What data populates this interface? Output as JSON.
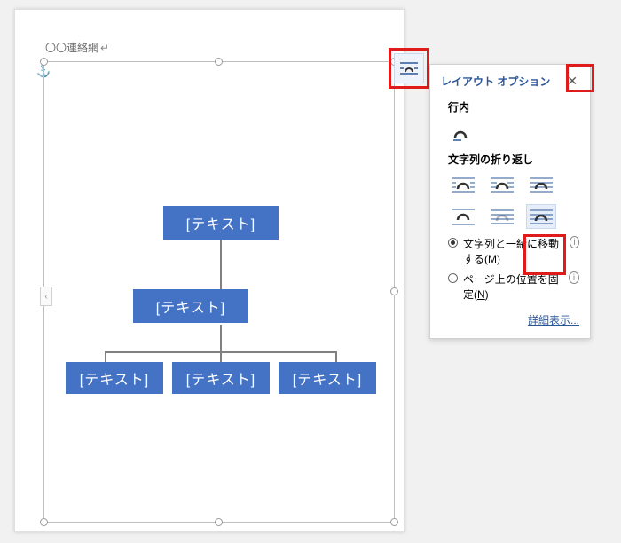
{
  "doc": {
    "title": "〇〇連絡網"
  },
  "smartart": {
    "nodes": {
      "root": "[テキスト]",
      "mid": "[テキスト]",
      "leaf1": "[テキスト]",
      "leaf2": "[テキスト]",
      "leaf3": "[テキスト]"
    },
    "expand": "‹"
  },
  "panel": {
    "title": "レイアウト オプション",
    "inline_label": "行内",
    "wrap_label": "文字列の折り返し",
    "move_with_text_prefix": "文字列と一緒に移動する(",
    "move_with_text_key": "M",
    "move_with_text_suffix": ")",
    "fix_position_prefix": "ページ上の位置を固定(",
    "fix_position_key": "N",
    "fix_position_suffix": ")",
    "more_link": "詳細表示..."
  }
}
